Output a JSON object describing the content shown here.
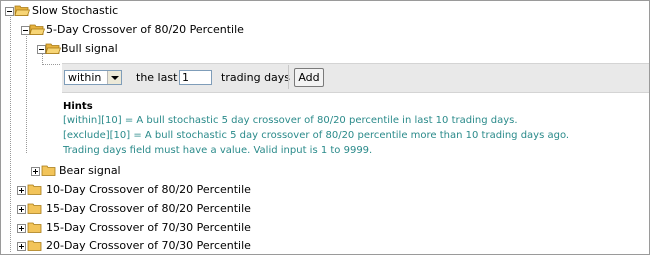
{
  "tree": {
    "root": {
      "label": "Slow Stochastic"
    },
    "crossover_5": {
      "label": "5-Day Crossover of 80/20 Percentile"
    },
    "bull": {
      "label": "Bull signal"
    },
    "bear": {
      "label": "Bear signal"
    },
    "others": [
      {
        "label": "10-Day Crossover of 80/20 Percentile"
      },
      {
        "label": "15-Day Crossover of 80/20 Percentile"
      },
      {
        "label": "15-Day Crossover of 70/30 Percentile"
      },
      {
        "label": "20-Day Crossover of 70/30 Percentile"
      }
    ]
  },
  "form": {
    "mode_value": "within",
    "the_last_label": "the last",
    "days_value": "1",
    "trading_days_label": "trading days",
    "add_label": "Add"
  },
  "hints": {
    "title": "Hints",
    "lines": [
      "[within][10] = A bull stochastic 5 day crossover of 80/20 percentile in last 10 trading days.",
      "[exclude][10] = A bull stochastic 5 day crossover of 80/20 percentile more than 10 trading days ago.",
      "Trading days field must have a value. Valid input is 1 to 9999."
    ],
    "color": "#2a8a8a"
  },
  "colors": {
    "folder": "#f2c45a",
    "panel": "#e9e9e9"
  }
}
